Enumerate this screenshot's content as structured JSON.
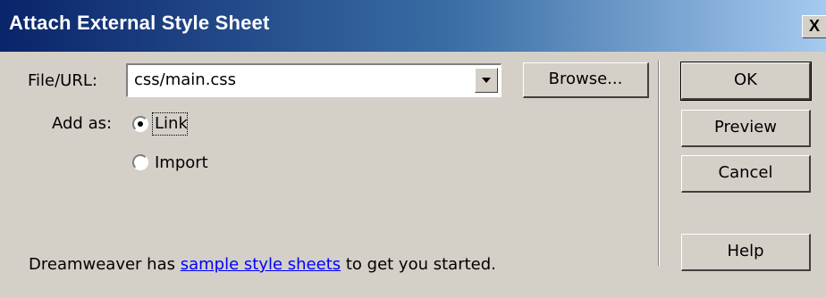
{
  "window": {
    "title": "Attach External Style Sheet",
    "close_label": "X"
  },
  "file": {
    "label": "File/URL:",
    "value": "css/main.css",
    "browse_label": "Browse..."
  },
  "add_as": {
    "label": "Add as:",
    "options": [
      {
        "label": "Link",
        "selected": true
      },
      {
        "label": "Import",
        "selected": false
      }
    ]
  },
  "buttons": {
    "ok": "OK",
    "preview": "Preview",
    "cancel": "Cancel",
    "help": "Help"
  },
  "footer": {
    "prefix": "Dreamweaver has ",
    "link": "sample style sheets",
    "suffix": " to get you started."
  },
  "colors": {
    "face": "#d4d0c8",
    "title_start": "#0a246a",
    "title_end": "#a6caf0",
    "link": "#0000ff"
  }
}
